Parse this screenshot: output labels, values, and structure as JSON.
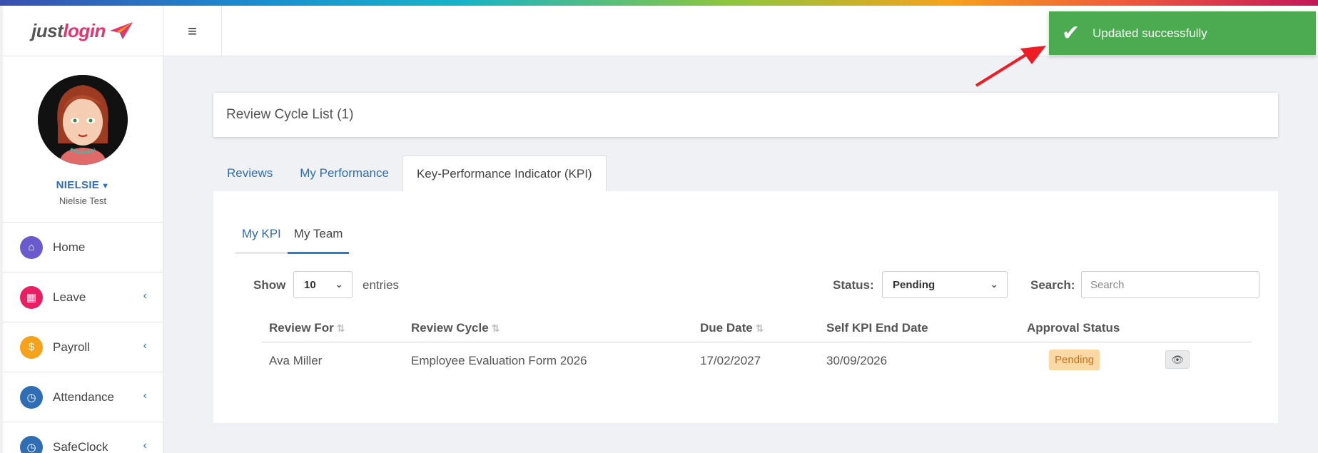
{
  "brand": {
    "logo_part1": "just",
    "logo_part2": "login"
  },
  "user": {
    "name": "NIELSIE",
    "subtitle": "Nielsie Test"
  },
  "sidebar": {
    "items": [
      {
        "label": "Home",
        "icon": "home-icon",
        "color": "#6a5acd"
      },
      {
        "label": "Leave",
        "icon": "calendar-icon",
        "color": "#e91e63"
      },
      {
        "label": "Payroll",
        "icon": "payroll-icon",
        "color": "#f6a21c"
      },
      {
        "label": "Attendance",
        "icon": "clock-icon",
        "color": "#2f6db5"
      },
      {
        "label": "SafeClock",
        "icon": "clock-icon",
        "color": "#2f6db5"
      }
    ]
  },
  "toast": {
    "message": "Updated successfully",
    "color": "#4caa50"
  },
  "page": {
    "title": "Review Cycle List (1)"
  },
  "tabs": [
    "Reviews",
    "My Performance",
    "Key-Performance Indicator (KPI)"
  ],
  "subtabs": [
    "My KPI",
    "My Team"
  ],
  "controls": {
    "show_label": "Show",
    "entries_value": "10",
    "entries_label": "entries",
    "status_label": "Status:",
    "status_value": "Pending",
    "search_label": "Search:",
    "search_placeholder": "Search"
  },
  "table": {
    "headers": [
      "Review For",
      "Review Cycle",
      "Due Date",
      "Self KPI End Date",
      "Approval Status"
    ],
    "rows": [
      {
        "review_for": "Ava Miller",
        "review_cycle": "Employee Evaluation Form 2026",
        "due_date": "17/02/2027",
        "self_kpi_end_date": "30/09/2026",
        "approval_status": "Pending"
      }
    ]
  }
}
